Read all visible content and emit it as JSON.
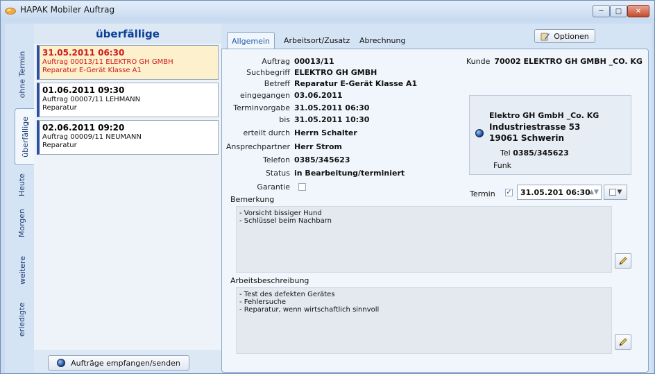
{
  "window": {
    "title": "HAPAK Mobiler Auftrag"
  },
  "vtabs": [
    "ohne Termin",
    "überfällige",
    "Heute",
    "Morgen",
    "weitere",
    "erledigte"
  ],
  "list": {
    "heading": "überfällige",
    "orders": [
      {
        "datetime": "31.05.2011 06:30",
        "line1": "Auftrag 00013/11  ELEKTRO GH GMBH",
        "line2": "Reparatur E-Gerät Klasse A1"
      },
      {
        "datetime": "01.06.2011 09:30",
        "line1": "Auftrag 00007/11  LEHMANN",
        "line2": "Reparatur"
      },
      {
        "datetime": "02.06.2011 09:20",
        "line1": "Auftrag 00009/11  NEUMANN",
        "line2": "Reparatur"
      }
    ],
    "send_button": "Aufträge empfangen/senden"
  },
  "tabs": [
    "Allgemein",
    "Arbeitsort/Zusatz",
    "Abrechnung"
  ],
  "options_button": "Optionen",
  "fields": [
    {
      "label": "Auftrag",
      "value": "00013/11"
    },
    {
      "label": "Suchbegriff",
      "value": "ELEKTRO GH GMBH"
    },
    {
      "label": "Betreff",
      "value": "Reparatur E-Gerät Klasse A1"
    },
    {
      "label": "eingegangen",
      "value": "03.06.2011"
    },
    {
      "label": "Terminvorgabe",
      "value": "31.05.2011  06:30"
    },
    {
      "label": "bis",
      "value": "31.05.2011  10:30"
    },
    {
      "label": "erteilt durch",
      "value": "Herrn Schalter"
    },
    {
      "label": "Ansprechpartner",
      "value": "Herr Strom"
    },
    {
      "label": "Telefon",
      "value": "0385/345623"
    },
    {
      "label": "Status",
      "value": "in Bearbeitung/terminiert"
    }
  ],
  "garantie_label": "Garantie",
  "kunde": {
    "label": "Kunde",
    "value": "70002  ELEKTRO GH GMBH _CO. KG"
  },
  "customer": {
    "name": "Elektro GH GmbH _Co. KG",
    "street": "Industriestrasse 53",
    "city": "19061  Schwerin",
    "tel_label": "Tel",
    "tel": "0385/345623",
    "funk_label": "Funk"
  },
  "termin": {
    "label": "Termin",
    "value": "31.05.201 06:30"
  },
  "bemerkung": {
    "label": "Bemerkung",
    "lines": [
      "- Vorsicht bissiger Hund",
      "- Schlüssel beim Nachbarn"
    ]
  },
  "arbeitsbeschreibung": {
    "label": "Arbeitsbeschreibung",
    "lines": [
      "- Test des defekten Gerätes",
      "- Fehlersuche",
      "- Reparatur, wenn wirtschaftlich sinnvoll"
    ]
  }
}
